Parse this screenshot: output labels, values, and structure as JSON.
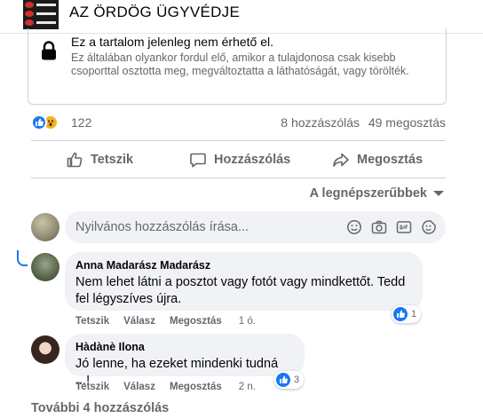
{
  "page": {
    "title": "AZ ÖRDÖG ÜGYVÉDJE"
  },
  "unavailable": {
    "title": "Ez a tartalom jelenleg nem érhető el.",
    "description": "Ez általában olyankor fordul elő, amikor a tulajdonosa csak kisebb csoporttal osztotta meg, megváltoztatta a láthatóságát, vagy törölték.",
    "icon": "lock-icon"
  },
  "stats": {
    "reactions_count": "122",
    "comments": "8 hozzászólás",
    "shares": "49 megosztás",
    "reaction_icons": [
      "like-icon",
      "wow-icon"
    ]
  },
  "actions": {
    "like": "Tetszik",
    "comment": "Hozzászólás",
    "share": "Megosztás"
  },
  "sort": {
    "label": "A legnépszerűbbek"
  },
  "composer": {
    "placeholder": "Nyilvános hozzászólás írása...",
    "icons": [
      "emoji-icon",
      "camera-icon",
      "gif-icon",
      "sticker-icon"
    ]
  },
  "comments": [
    {
      "author": "Anna Madarász Madarász",
      "text": "Nem lehet látni a posztot vagy fotót vagy mindkettőt. Tedd fel légyszíves újra.",
      "like_label": "Tetszik",
      "reply_label": "Válasz",
      "share_label": "Megosztás",
      "time": "1 ó.",
      "reaction_count": "1"
    },
    {
      "author": "Hàdànè Ilona",
      "text": "Jó lenne, ha ezeket mindenki tudná ...!",
      "like_label": "Tetszik",
      "reply_label": "Válasz",
      "share_label": "Megosztás",
      "time": "2 n.",
      "reaction_count": "3"
    }
  ],
  "more_comments": "További 4 hozzászólás",
  "colors": {
    "accent": "#1877f2",
    "secondary_text": "#65676b",
    "bubble": "#f0f2f5",
    "wow": "#f7b125"
  }
}
